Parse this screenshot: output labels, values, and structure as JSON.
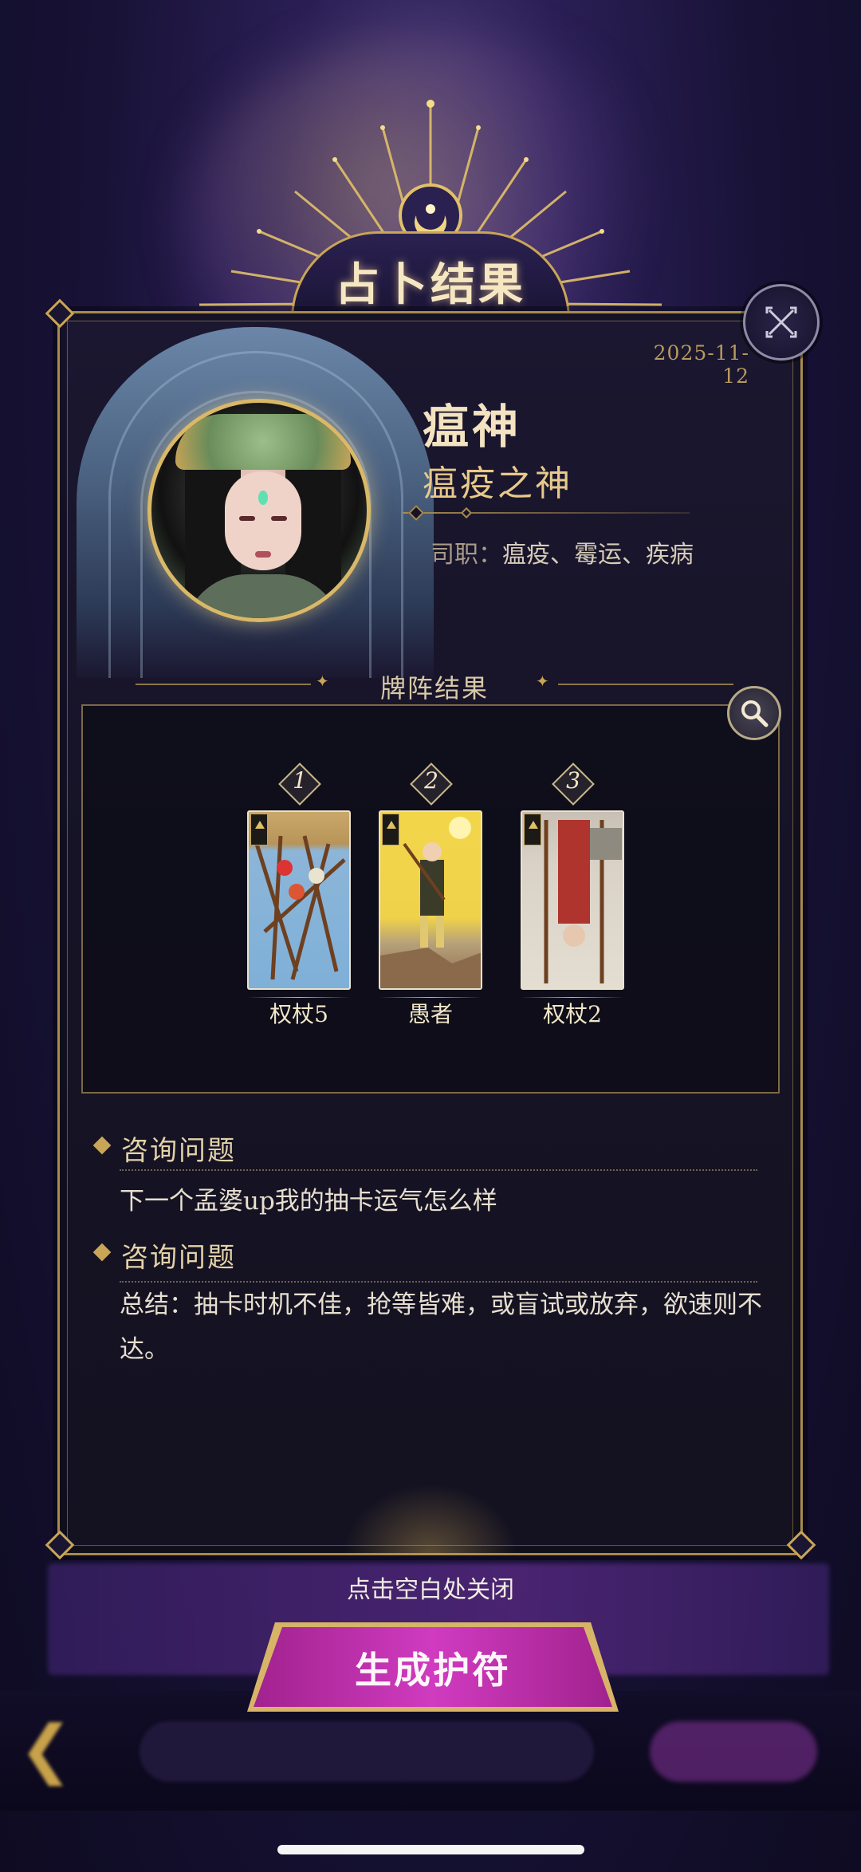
{
  "header": {
    "title": "占卜结果",
    "date": "2025-11-12"
  },
  "deity": {
    "name": "瘟神",
    "title": "瘟疫之神",
    "duties_label": "司职：",
    "duties_value": "瘟疫、霉运、疾病"
  },
  "spread": {
    "section_title": "牌阵结果",
    "cards": [
      {
        "number": "1",
        "name": "权杖5",
        "image": "five-of-wands",
        "reversed": true
      },
      {
        "number": "2",
        "name": "愚者",
        "image": "the-fool",
        "reversed": false
      },
      {
        "number": "3",
        "name": "权杖2",
        "image": "two-of-wands",
        "reversed": true
      }
    ]
  },
  "consultation": [
    {
      "heading": "咨询问题",
      "text": "下一个孟婆up我的抽卡运气怎么样"
    },
    {
      "heading": "咨询问题",
      "text": "总结：抽卡时机不佳，抢等皆难，或盲试或放弃，欲速则不达。"
    }
  ],
  "footer": {
    "tap_to_close": "点击空白处关闭",
    "generate_button": "生成护符"
  },
  "colors": {
    "gold": "#c9a557",
    "button_magenta": "#d03bc0",
    "card_bg": "#161326"
  }
}
